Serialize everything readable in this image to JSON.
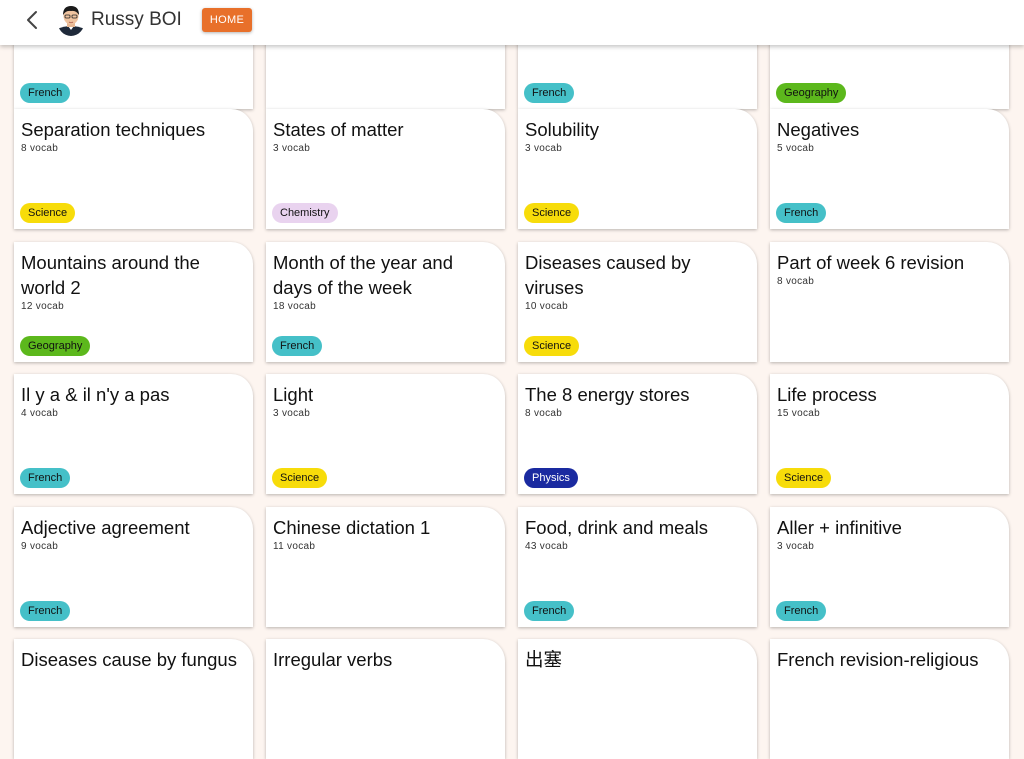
{
  "header": {
    "user_name": "Russy BOI",
    "home_label": "HOME"
  },
  "tag_colors": {
    "French": "#45c0c8",
    "Geography": "#5cb81c",
    "Science": "#f7dc0a",
    "Chemistry": "#e9d3ef",
    "Physics": "#1a2aa0"
  },
  "rows": [
    [
      {
        "title": "",
        "count": "",
        "tag": "French"
      },
      {
        "title": "",
        "count": "",
        "tag": ""
      },
      {
        "title": "",
        "count": "",
        "tag": "French"
      },
      {
        "title": "",
        "count": "",
        "tag": "Geography"
      }
    ],
    [
      {
        "title": "Separation techniques",
        "count": "8 vocab",
        "tag": "Science"
      },
      {
        "title": "States of matter",
        "count": "3 vocab",
        "tag": "Chemistry"
      },
      {
        "title": "Solubility",
        "count": "3 vocab",
        "tag": "Science"
      },
      {
        "title": "Negatives",
        "count": "5 vocab",
        "tag": "French"
      }
    ],
    [
      {
        "title": "Mountains around the world 2",
        "count": "12 vocab",
        "tag": "Geography"
      },
      {
        "title": "Month of the year and days of the week",
        "count": "18 vocab",
        "tag": "French"
      },
      {
        "title": "Diseases caused by viruses",
        "count": "10 vocab",
        "tag": "Science"
      },
      {
        "title": "Part of week 6 revision",
        "count": "8 vocab",
        "tag": ""
      }
    ],
    [
      {
        "title": "Il y a & il n'y a pas",
        "count": "4 vocab",
        "tag": "French"
      },
      {
        "title": "Light",
        "count": "3 vocab",
        "tag": "Science"
      },
      {
        "title": "The 8 energy stores",
        "count": "8 vocab",
        "tag": "Physics"
      },
      {
        "title": "Life process",
        "count": "15 vocab",
        "tag": "Science"
      }
    ],
    [
      {
        "title": "Adjective agreement",
        "count": "9 vocab",
        "tag": "French"
      },
      {
        "title": "Chinese dictation 1",
        "count": "11 vocab",
        "tag": ""
      },
      {
        "title": "Food, drink and meals",
        "count": "43 vocab",
        "tag": "French"
      },
      {
        "title": "Aller + infinitive",
        "count": "3 vocab",
        "tag": "French"
      }
    ],
    [
      {
        "title": "Diseases cause by fungus",
        "count": "",
        "tag": ""
      },
      {
        "title": "Irregular verbs",
        "count": "",
        "tag": ""
      },
      {
        "title": "出塞",
        "count": "",
        "tag": ""
      },
      {
        "title": "French revision-religious",
        "count": "",
        "tag": ""
      }
    ]
  ]
}
